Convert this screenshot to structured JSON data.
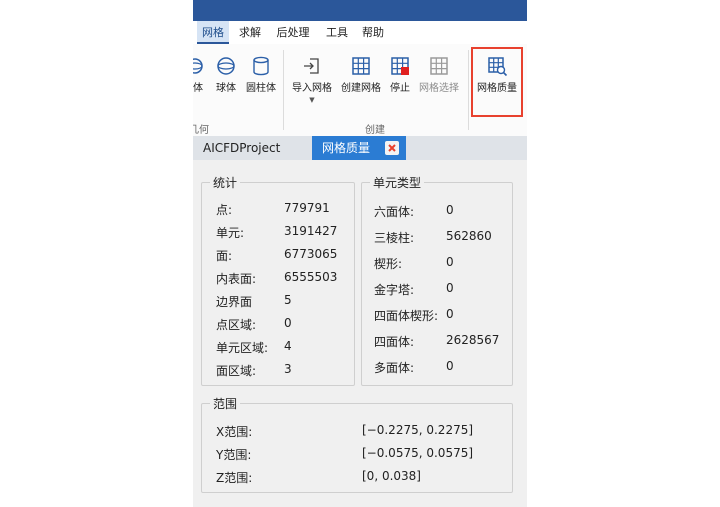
{
  "menu": {
    "tabs": [
      "网格",
      "求解",
      "后处理",
      "工具",
      "帮助"
    ],
    "active": "网格"
  },
  "ribbon": {
    "buttons_left": [
      {
        "label": "体",
        "icon": "sphere-partial-icon"
      },
      {
        "label": "球体",
        "icon": "sphere-icon"
      },
      {
        "label": "圆柱体",
        "icon": "cylinder-icon"
      }
    ],
    "left_group_label": "几何",
    "buttons": [
      {
        "label": "导入网格",
        "icon": "import-mesh-icon",
        "dropdown": true,
        "enabled": true
      },
      {
        "label": "创建网格",
        "icon": "create-mesh-icon",
        "enabled": true
      },
      {
        "label": "停止",
        "icon": "stop-icon",
        "enabled": true
      },
      {
        "label": "网格选择",
        "icon": "mesh-select-icon",
        "enabled": false
      }
    ],
    "group_label": "创建",
    "quality_button": {
      "label": "网格质量",
      "icon": "mesh-quality-icon",
      "highlighted": true
    }
  },
  "tabs": {
    "project": "AICFDProject",
    "quality": "网格质量"
  },
  "stats": {
    "title": "统计",
    "rows": [
      {
        "label": "点:",
        "value": "779791"
      },
      {
        "label": "单元:",
        "value": "3191427"
      },
      {
        "label": "面:",
        "value": "6773065"
      },
      {
        "label": "内表面:",
        "value": "6555503"
      },
      {
        "label": "边界面",
        "value": "5"
      },
      {
        "label": "点区域:",
        "value": "0"
      },
      {
        "label": "单元区域:",
        "value": "4"
      },
      {
        "label": "面区域:",
        "value": "3"
      }
    ]
  },
  "cell_types": {
    "title": "单元类型",
    "rows": [
      {
        "label": "六面体:",
        "value": "0"
      },
      {
        "label": "三棱柱:",
        "value": "562860"
      },
      {
        "label": "楔形:",
        "value": "0"
      },
      {
        "label": "金字塔:",
        "value": "0"
      },
      {
        "label": "四面体楔形:",
        "value": "0"
      },
      {
        "label": "四面体:",
        "value": "2628567"
      },
      {
        "label": "多面体:",
        "value": "0"
      }
    ]
  },
  "range": {
    "title": "范围",
    "rows": [
      {
        "label": "X范围:",
        "value": "[−0.2275, 0.2275]"
      },
      {
        "label": "Y范围:",
        "value": "[−0.0575, 0.0575]"
      },
      {
        "label": "Z范围:",
        "value": "[0, 0.038]"
      }
    ]
  },
  "colors": {
    "titlebar": "#2b579a",
    "active_tab": "#2b7cd3",
    "highlight": "#e8412e",
    "stop_red": "#e02020"
  }
}
